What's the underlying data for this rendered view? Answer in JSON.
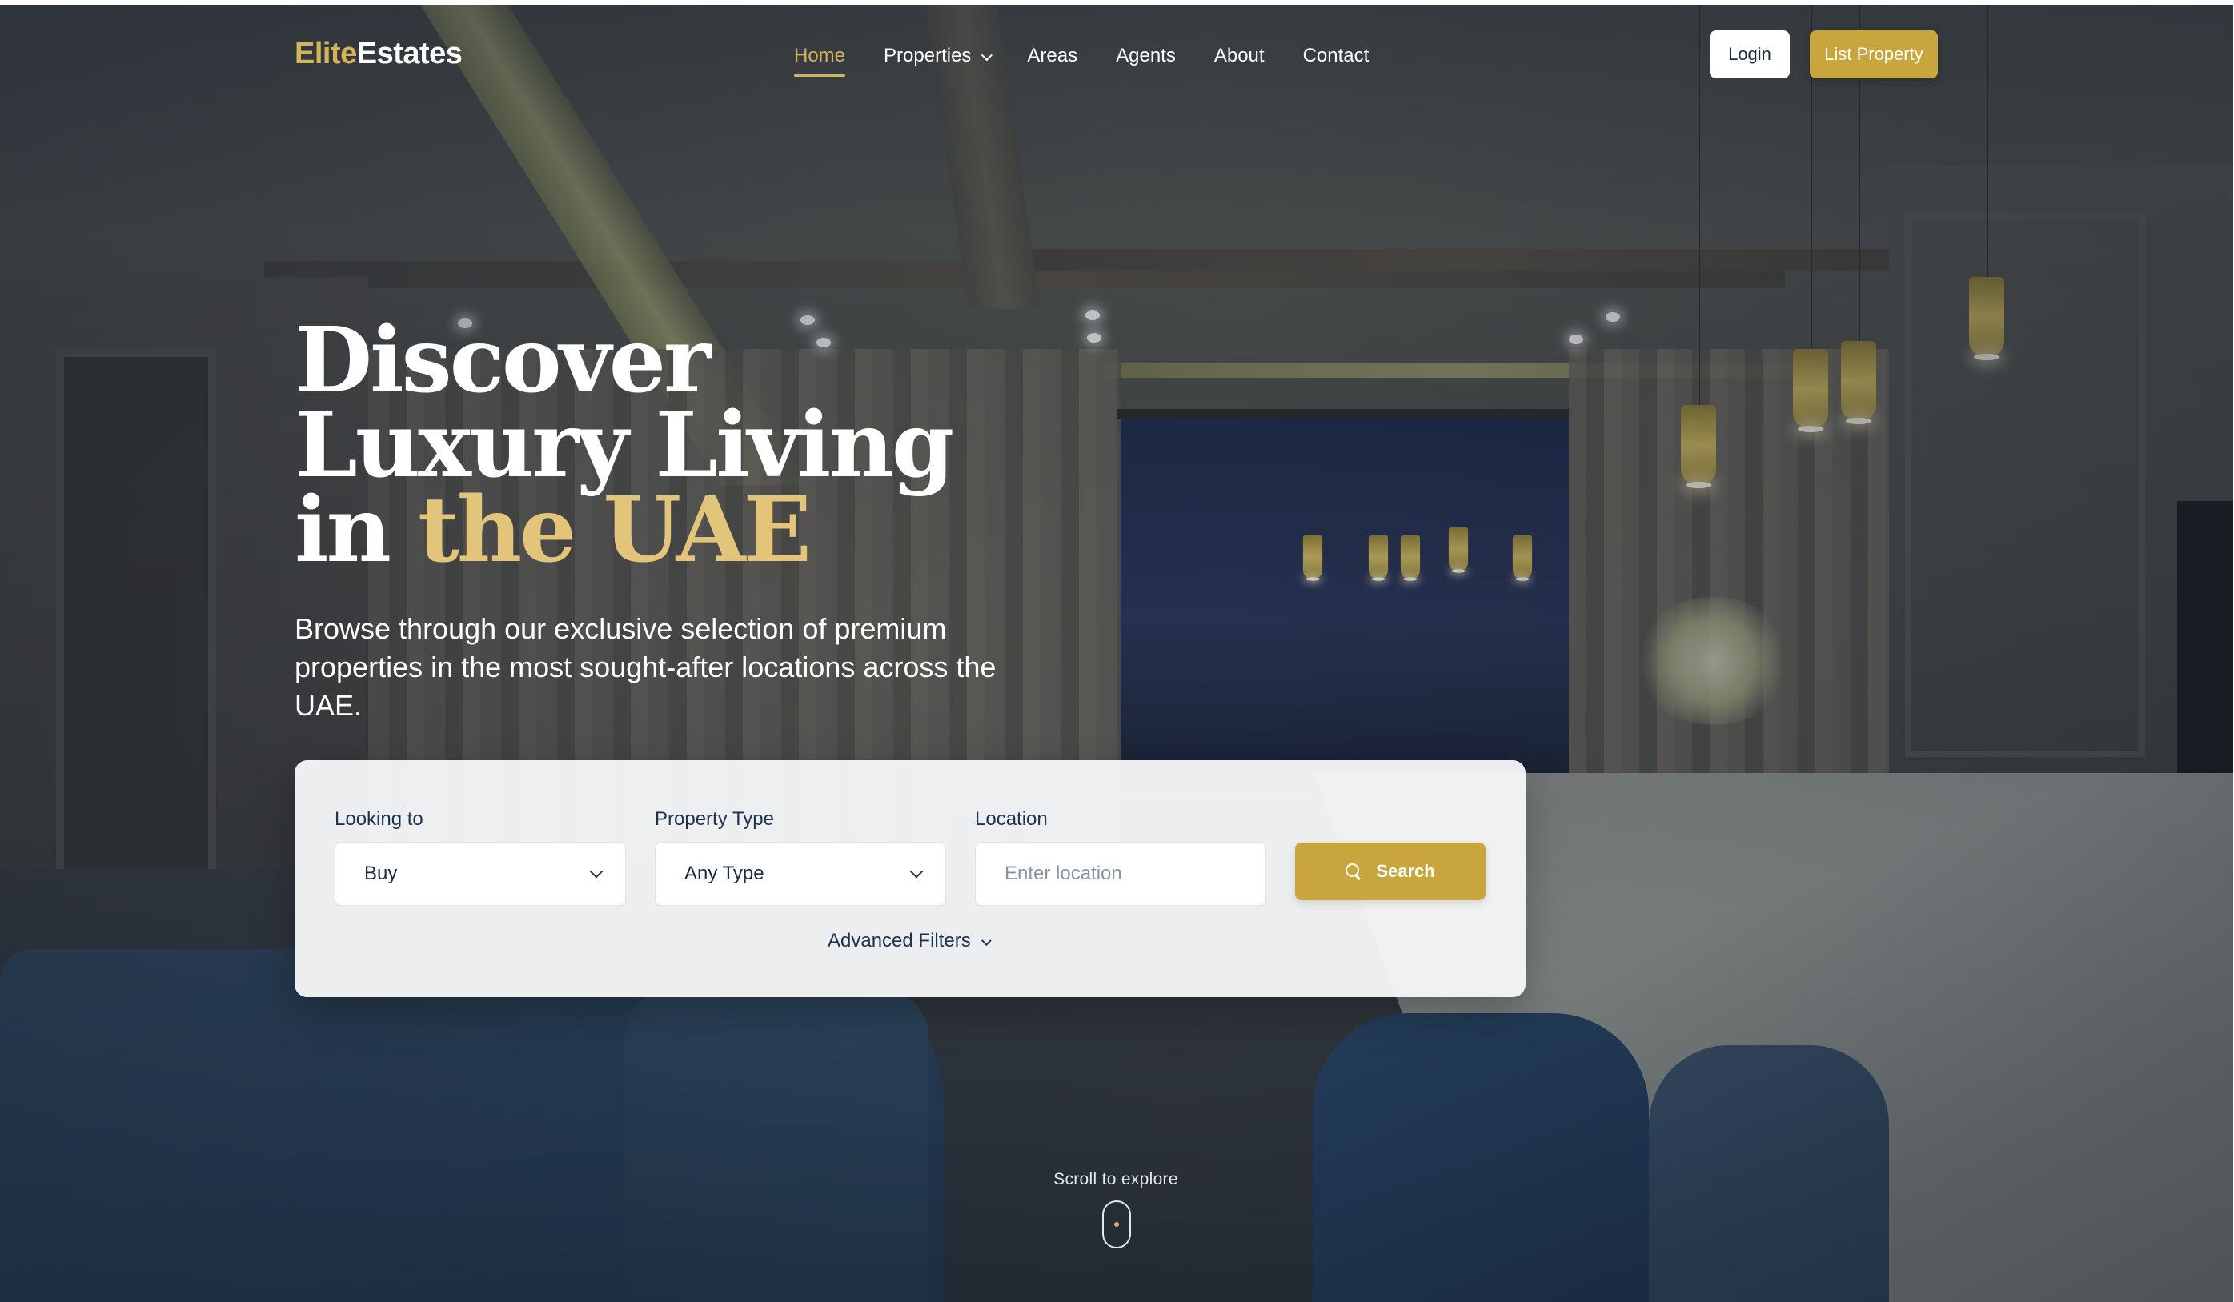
{
  "brand": {
    "prefix": "Elite",
    "suffix": "Estates",
    "accent_color": "#d4b457"
  },
  "nav": {
    "links": [
      {
        "label": "Home",
        "active": true
      },
      {
        "label": "Properties",
        "has_dropdown": true
      },
      {
        "label": "Areas"
      },
      {
        "label": "Agents"
      },
      {
        "label": "About"
      },
      {
        "label": "Contact"
      }
    ],
    "login_label": "Login",
    "list_property_label": "List Property"
  },
  "hero": {
    "headline_line1": "Discover",
    "headline_line2": "Luxury Living",
    "headline_line3_prefix": "in ",
    "headline_line3_accent": "the UAE",
    "subheading": "Browse through our exclusive selection of premium properties in the most sought-after locations across the UAE."
  },
  "search": {
    "looking_to": {
      "label": "Looking to",
      "value": "Buy"
    },
    "property_type": {
      "label": "Property Type",
      "value": "Any Type"
    },
    "location": {
      "label": "Location",
      "placeholder": "Enter location"
    },
    "search_button_label": "Search",
    "advanced_filters_label": "Advanced Filters"
  },
  "scroll_hint": "Scroll to explore",
  "colors": {
    "gold": "#c9a53e",
    "navy_text": "#1d3350",
    "white": "#ffffff"
  }
}
